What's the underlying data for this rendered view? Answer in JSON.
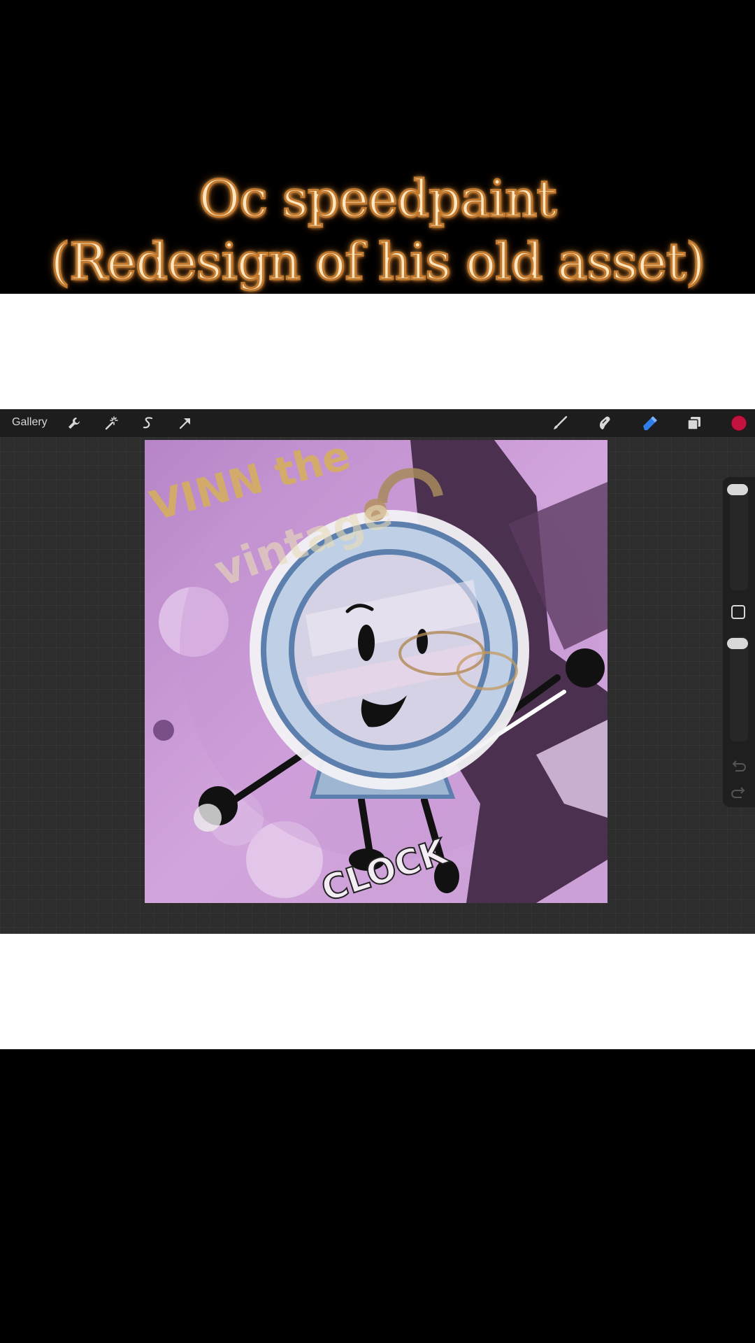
{
  "caption": {
    "line1": "Oc speedpaint",
    "line2": "(Redesign of his old asset)"
  },
  "toolbar": {
    "gallery_label": "Gallery",
    "left_icons": [
      "wrench-icon",
      "magic-wand-icon",
      "selection-icon",
      "transform-arrow-icon"
    ],
    "right_icons": [
      "brush-icon",
      "smudge-icon",
      "eraser-icon",
      "layers-icon",
      "color-swatch"
    ],
    "active_tool": "eraser",
    "active_color": "#c2123e"
  },
  "artwork": {
    "text_top": "VINN the",
    "text_middle": "vintage",
    "text_bottom": "CLOCK"
  },
  "side_panel": {
    "controls": [
      "brush-size-slider",
      "modify-button",
      "opacity-slider",
      "undo-button",
      "redo-button"
    ]
  }
}
